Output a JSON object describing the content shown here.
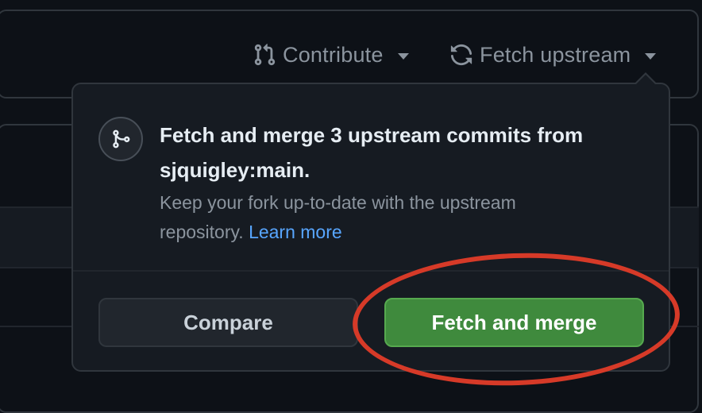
{
  "header": {
    "contribute_label": "Contribute",
    "fetch_upstream_label": "Fetch upstream"
  },
  "popover": {
    "title": "Fetch and merge 3 upstream commits from sjquigley:main.",
    "description": "Keep your fork up-to-date with the upstream repository.",
    "learn_more": "Learn more",
    "compare_label": "Compare",
    "fetch_merge_label": "Fetch and merge"
  },
  "colors": {
    "background": "#0d1117",
    "popover_bg": "#161b22",
    "primary_button": "#3f8a3d",
    "link": "#58a6ff",
    "highlight": "#d63a28"
  },
  "icons": {
    "contribute": "git-pull-request-icon",
    "fetch": "sync-icon",
    "merge": "git-merge-icon"
  }
}
